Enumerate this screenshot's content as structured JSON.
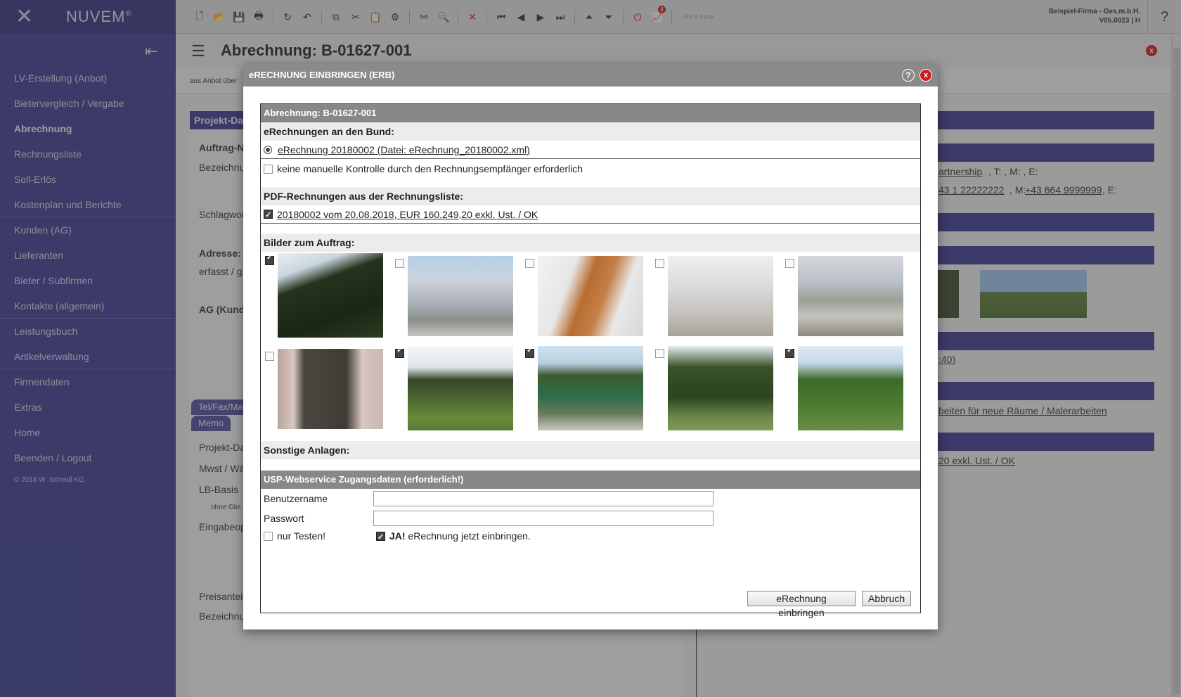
{
  "app": {
    "logo": "NUVEM",
    "logo_mark": "®",
    "company": "Beispiel-Firma - Ges.m.b.H.",
    "version": "V05.0023 | H",
    "help": "?"
  },
  "sidebar": {
    "items": [
      {
        "label": "LV-Erstellung (Anbot)"
      },
      {
        "label": "Bietervergleich / Vergabe"
      },
      {
        "label": "Abrechnung"
      },
      {
        "label": "Rechnungsliste"
      },
      {
        "label": "Soll-Erlös"
      },
      {
        "label": "Kostenplan und Berichte"
      },
      {
        "label": "Kunden (AG)"
      },
      {
        "label": "Lieferanten"
      },
      {
        "label": "Bieter / Subfirmen"
      },
      {
        "label": "Kontakte (allgemein)"
      },
      {
        "label": "Leistungsbuch"
      },
      {
        "label": "Artikelverwaltung"
      },
      {
        "label": "Firmendaten"
      },
      {
        "label": "Extras"
      },
      {
        "label": "Home"
      },
      {
        "label": "Beenden / Logout"
      }
    ],
    "copyright": "© 2018 W. Scheidl KG"
  },
  "toolbar": {
    "badge": "4"
  },
  "page": {
    "title": "Abrechnung: B-01627-001",
    "subbar": "aus Anbot über",
    "close": "x",
    "left_head": "Projekt-Da",
    "labels": [
      "Auftrag-N",
      "Bezeichnu",
      "Schlagwor",
      "Adresse:",
      "erfasst / g",
      "AG (Kund"
    ],
    "tabs": [
      "Tel/Fax/Ma",
      "Memo"
    ],
    "labels2": [
      "Projekt-Da",
      "Mwst / Wä",
      "LB-Basis",
      "ohne Glie",
      "Eingabeop",
      "Preisantei",
      "Bezeichnu"
    ],
    "right_texts": [
      "artnership",
      ", T: , M: , E:",
      "43 1 22222222",
      ", M:",
      "+43 664 9999999",
      ", E:",
      ":40)",
      "beiten für neue Räume / Malerarbeiten",
      "20 exkl. Ust. / OK"
    ]
  },
  "modal": {
    "title": "eRECHNUNG EINBRINGEN (ERB)",
    "help": "?",
    "close": "x",
    "header": "Abrechnung: B-01627-001",
    "bund_head": "eRechnungen an den Bund:",
    "bund_item": "eRechnung 20180002 (Datei: eRechnung_20180002.xml)",
    "no_manual_check": "keine manuelle Kontrolle durch den Rechnungsempfänger erforderlich",
    "pdf_head": "PDF-Rechnungen aus der Rechnungsliste:",
    "pdf_item": "20180002 vom 20.08.2018,  EUR 160.249,20 exkl. Ust. / OK",
    "images_head": "Bilder zum Auftrag:",
    "images": [
      {
        "name": "forest-trees",
        "checked": true
      },
      {
        "name": "house-exterior",
        "checked": false
      },
      {
        "name": "staircase",
        "checked": false
      },
      {
        "name": "interior-construction",
        "checked": false
      },
      {
        "name": "empty-room",
        "checked": false
      },
      {
        "name": "door-closet",
        "checked": false
      },
      {
        "name": "garden-lawn",
        "checked": true
      },
      {
        "name": "fence-car",
        "checked": true
      },
      {
        "name": "pine-trees",
        "checked": false
      },
      {
        "name": "tree-pole",
        "checked": true
      }
    ],
    "other_head": "Sonstige Anlagen:",
    "usp_head": "USP-Webservice Zugangsdaten (erforderlich!)",
    "username_label": "Benutzername",
    "username_value": "",
    "password_label": "Passwort",
    "password_value": "",
    "test_label": "nur Testen!",
    "confirm_bold": "JA!",
    "confirm_text": " eRechnung jetzt einbringen.",
    "submit": "eRechnung einbringen",
    "cancel": "Abbruch"
  }
}
